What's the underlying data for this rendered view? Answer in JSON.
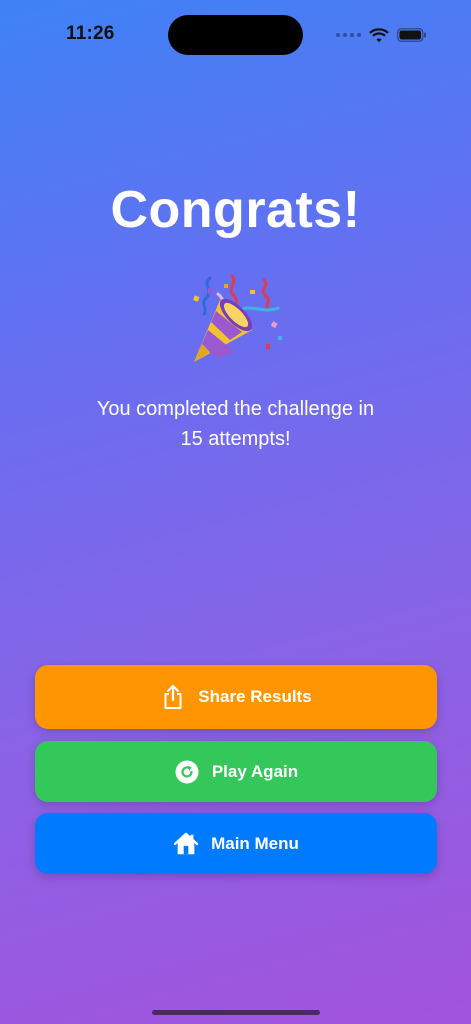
{
  "status_bar": {
    "time": "11:26",
    "icons": [
      "cellular-signal-icon",
      "wifi-icon",
      "battery-icon"
    ]
  },
  "screen": {
    "title": "Congrats!",
    "emoji_icon": "party-popper-icon",
    "message_line1": "You completed the challenge in",
    "message_line2": "15 attempts!"
  },
  "buttons": {
    "share": {
      "label": "Share Results",
      "icon": "share-icon",
      "color": "#ff9500"
    },
    "play_again": {
      "label": "Play Again",
      "icon": "replay-icon",
      "color": "#34c759"
    },
    "main_menu": {
      "label": "Main Menu",
      "icon": "house-icon",
      "color": "#007aff"
    }
  }
}
